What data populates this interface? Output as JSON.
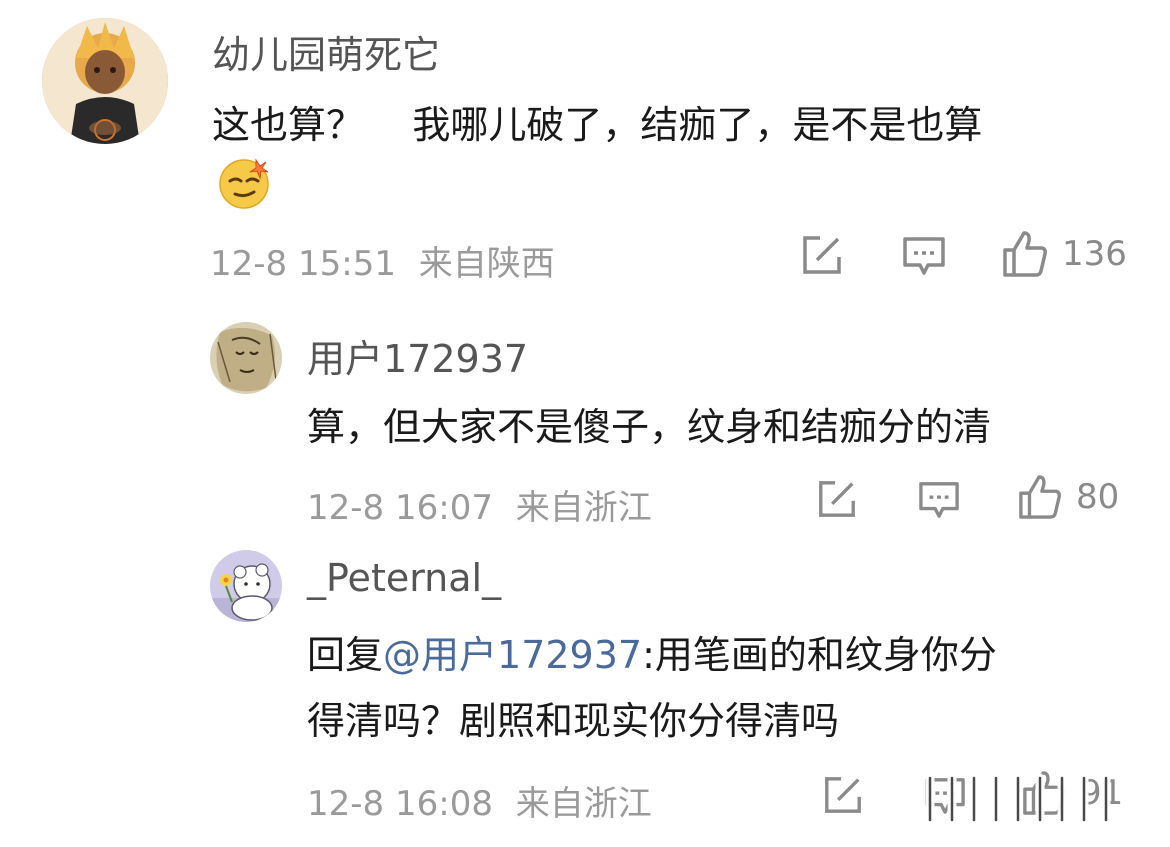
{
  "comments": [
    {
      "username": "幼儿园萌死它",
      "text_line1": "这也算？    我哪儿破了，结痂了，是不是也算",
      "emoji": "smirk-face",
      "time": "12-8 15:51",
      "location": "来自陕西",
      "likes": "136"
    },
    {
      "username": "用户172937",
      "text_line1": "算，但大家不是傻子，纹身和结痂分的清",
      "time": "12-8 16:07",
      "location": "来自浙江",
      "likes": "80"
    },
    {
      "username": "_Peternal_",
      "reply_prefix": "回复",
      "mention": "@用户172937",
      "text_after_mention": ":用笔画的和纹身你分",
      "text_line2": "得清吗？剧照和现实你分得清吗",
      "time": "12-8 16:08",
      "location": "来自浙江",
      "likes": "91"
    }
  ],
  "colors": {
    "username": "#555555",
    "meta": "#9a9a9a",
    "mention": "#4a6a9a",
    "icon": "#8a8a8a"
  },
  "icons": [
    "edit-icon",
    "comment-icon",
    "thumbs-up-icon"
  ]
}
